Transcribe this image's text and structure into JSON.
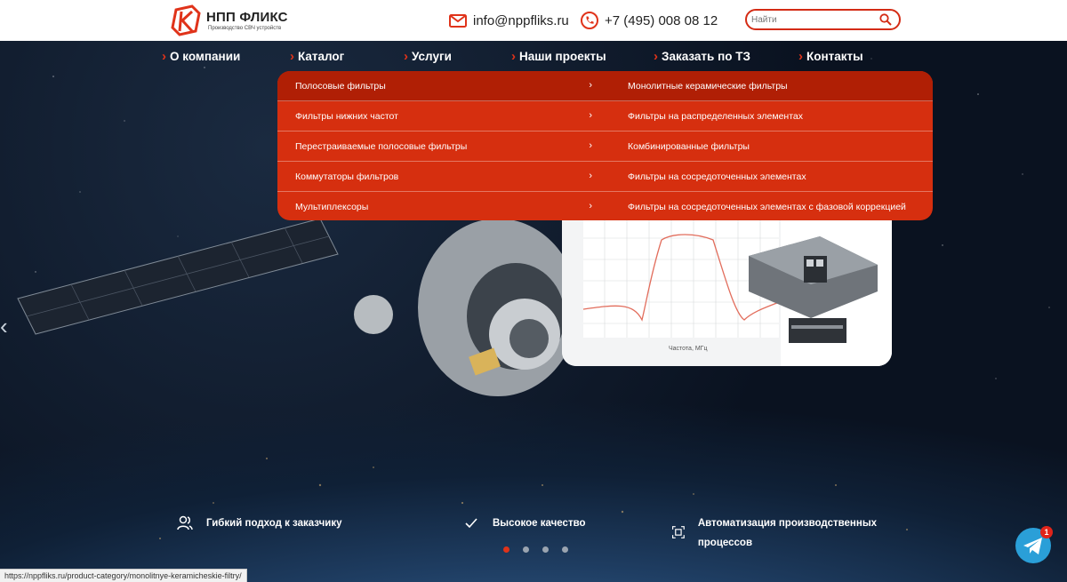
{
  "header": {
    "logo_title": "НПП ФЛИКС",
    "logo_subtitle": "Производство СВЧ устройств",
    "email": "info@nppfliks.ru",
    "phone": "+7 (495) 008 08 12",
    "search_placeholder": "Найти",
    "accent_color": "#d42b14"
  },
  "nav": {
    "items": [
      {
        "label": "О компании"
      },
      {
        "label": "Каталог"
      },
      {
        "label": "Услуги"
      },
      {
        "label": "Наши проекты"
      },
      {
        "label": "Заказать по ТЗ"
      },
      {
        "label": "Контакты"
      }
    ]
  },
  "catalog_menu": {
    "left": [
      {
        "label": "Полосовые фильтры"
      },
      {
        "label": "Фильтры нижних частот"
      },
      {
        "label": "Перестраиваемые полосовые фильтры"
      },
      {
        "label": "Коммутаторы фильтров"
      },
      {
        "label": "Мультиплексоры"
      }
    ],
    "right": [
      {
        "label": "Монолитные керамические фильтры"
      },
      {
        "label": "Фильтры на распределенных элементах"
      },
      {
        "label": "Комбинированные фильтры"
      },
      {
        "label": "Фильтры на сосредоточенных элементах"
      },
      {
        "label": "Фильтры на сосредоточенных элементах с фазовой коррекцией"
      }
    ],
    "chevron": "›"
  },
  "graph": {
    "xlabel": "Частота, МГц"
  },
  "features": [
    {
      "label": "Гибкий подход к заказчику",
      "icon": "users-icon"
    },
    {
      "label": "Высокое качество",
      "icon": "check-icon"
    },
    {
      "label": "Автоматизация производственных процессов",
      "icon": "automation-icon"
    }
  ],
  "slider": {
    "count": 4,
    "active": 1,
    "prev_arrow": "‹"
  },
  "status_bar": "https://nppfliks.ru/product-category/monolitnye-keramicheskie-filtry/",
  "telegram": {
    "badge": "1",
    "color": "#2a9fd8"
  }
}
